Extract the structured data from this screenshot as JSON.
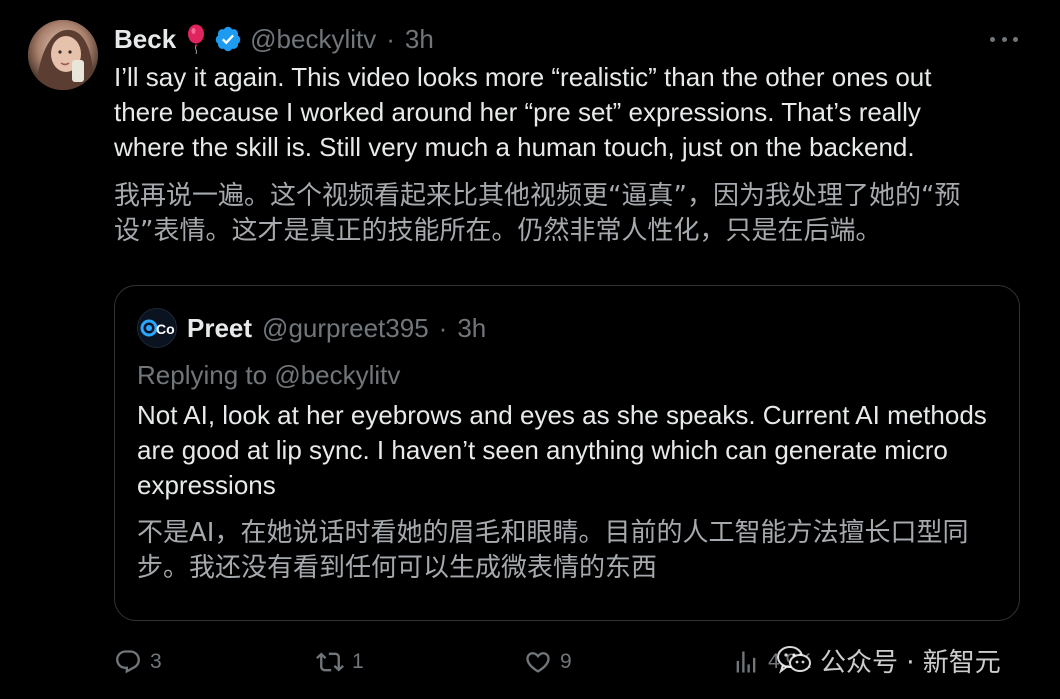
{
  "tweet": {
    "author_name": "Beck",
    "author_emoji": "🎈",
    "handle": "@beckylitv",
    "separator": "·",
    "time": "3h",
    "text": "I’ll say it again. This video looks more “realistic” than the other ones out there because I worked around her “pre set” expressions. That’s really where the skill is. Still very much a human touch, just on the backend.",
    "translation": "我再说一遍。这个视频看起来比其他视频更“逼真”，因为我处理了她的“预设”表情。这才是真正的技能所在。仍然非常人性化，只是在后端。"
  },
  "quote": {
    "author_name": "Preet",
    "handle": "@gurpreet395",
    "separator": "·",
    "time": "3h",
    "avatar_text": "Co",
    "replying_prefix": "Replying to",
    "replying_to": "@beckylitv",
    "text": "Not AI, look at her eyebrows and eyes as she speaks. Current AI methods are good at lip sync. I haven’t seen anything which can generate micro expressions",
    "translation": "不是AI，在她说话时看她的眉毛和眼睛。目前的人工智能方法擅长口型同步。我还没有看到任何可以生成微表情的东西"
  },
  "actions": {
    "replies": "3",
    "retweets": "1",
    "likes": "9",
    "views": "4.9K"
  },
  "watermark": {
    "text": "公众号 · 新智元"
  },
  "colors": {
    "background": "#000000",
    "primary_text": "#e7e9ea",
    "secondary_text": "#71767b",
    "translation_text": "#a6a9ad",
    "verified_blue": "#1d9bf0",
    "border": "#2f3336"
  },
  "icons": {
    "verified": "verified-badge-icon",
    "more": "more-dots-icon",
    "reply": "reply-bubble-icon",
    "retweet": "retweet-icon",
    "like": "heart-icon",
    "views": "views-bar-chart-icon",
    "wechat": "wechat-icon"
  }
}
